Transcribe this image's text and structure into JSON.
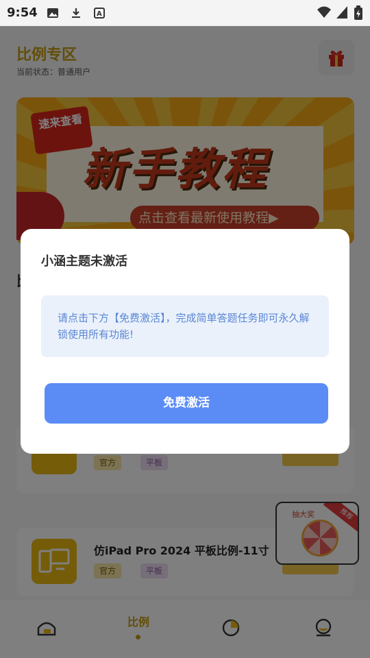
{
  "status_bar": {
    "time": "9:54"
  },
  "header": {
    "title": "比例专区",
    "status": "当前状态：普通用户"
  },
  "banner": {
    "badge": "速来查看",
    "title": "新手教程",
    "pill": "点击查看最新使用教程▶"
  },
  "section": {
    "title": "比"
  },
  "cards": [
    {
      "name": "",
      "tags": [
        "官方",
        "平板"
      ],
      "button": "",
      "icon": "tablet-icon"
    },
    {
      "name": "仿iPad Pro 2024 平板比例-11寸",
      "tags": [
        "官方",
        "平板"
      ],
      "button": "",
      "icon": "tablet-icon"
    }
  ],
  "floating_ad": {
    "label": "抽大奖",
    "ribbon": "推荐"
  },
  "tabbar": {
    "active_label": "比例",
    "icons": [
      "home-icon",
      "ratio-icon",
      "pie-chart-icon",
      "profile-icon"
    ]
  },
  "modal": {
    "title": "小涵主题未激活",
    "notice": "请点击下方【免费激活】，完成简单答题任务即可永久解锁使用所有功能!",
    "button": "免费激活"
  },
  "colors": {
    "accent": "#c59a10",
    "button": "#5b8cf6",
    "notice_text": "#5a86d6",
    "notice_bg": "#eaf1fb"
  }
}
